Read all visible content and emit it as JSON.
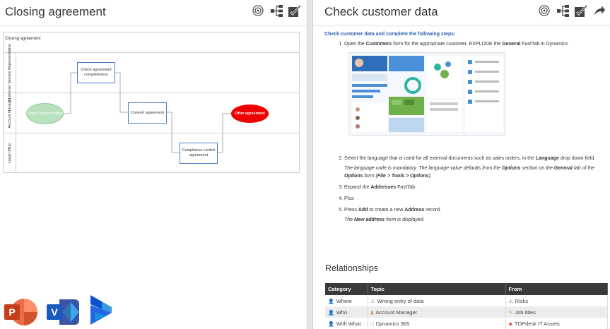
{
  "left": {
    "title": "Closing agreement",
    "toolbar": [
      "target-icon",
      "hierarchy-icon",
      "checklist-icon"
    ],
    "diagram": {
      "title": "Closing agreement",
      "lanes": [
        "Customer Service Representative",
        "Account Manager",
        "Legal office"
      ],
      "nodes": {
        "start": "Close customer data",
        "check": "Check agreement completeness",
        "convert": "Convert agreement",
        "compliance": "Compliance control agreement",
        "offer": "Offer agreement"
      }
    },
    "apps": [
      "powerpoint-app-icon",
      "visio-app-icon",
      "dynamics-app-icon"
    ],
    "app_letters": {
      "powerpoint": "P",
      "visio": "V"
    }
  },
  "right": {
    "title": "Check customer data",
    "toolbar": [
      "target-icon",
      "hierarchy-icon",
      "checklist-icon",
      "share-icon"
    ],
    "intro": "Check customer data and complete the following steps:",
    "steps": {
      "s1_a": "Open the ",
      "s1_b": "Customers",
      "s1_c": " form for the appropriate customer, EXPLODE the ",
      "s1_d": "General",
      "s1_e": " FastTab in Dynamics",
      "s2_a": "Select the language that is used for all external documents such as sales orders, in the ",
      "s2_b": "Language",
      "s2_c": " drop down field.",
      "s2_note_a": "The language code is mandatory. The language value defaults from the ",
      "s2_note_b": "Options",
      "s2_note_c": " section on the ",
      "s2_note_d": "General",
      "s2_note_e": " tab of the ",
      "s2_note_f": "Options",
      "s2_note_g": " form (",
      "s2_note_h": "File > Tools > Options",
      "s2_note_i": ").",
      "s3_a": "Expand the ",
      "s3_b": "Addresses",
      "s3_c": " FastTab.",
      "s4": "Plus",
      "s5_a": "Press ",
      "s5_b": "Add",
      "s5_c": " to create a new ",
      "s5_d": "Address",
      "s5_e": " record.",
      "s5_note_a": "The ",
      "s5_note_b": "New address",
      "s5_note_c": " form is displayed."
    },
    "relationships": {
      "title": "Relationships",
      "headers": [
        "Category",
        "Topic",
        "From"
      ],
      "rows": [
        {
          "category": "Where",
          "topic": "Wrong entry of data",
          "from": "Risks",
          "topic_icon": "warning-icon",
          "from_icon": "warning-icon"
        },
        {
          "category": "Who",
          "topic": "Account Manager",
          "from": "Job titles",
          "topic_icon": "role-icon",
          "from_icon": "job-icon"
        },
        {
          "category": "With What",
          "topic": "Dynamics 365",
          "from": "TOPdesk IT Assets",
          "topic_icon": "monitor-icon",
          "from_icon": "asset-icon"
        }
      ]
    }
  }
}
